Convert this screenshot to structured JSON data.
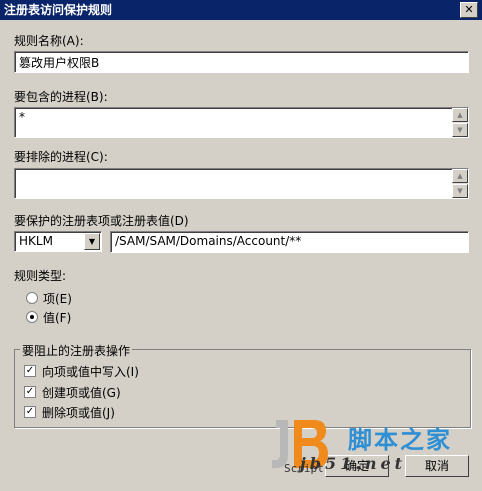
{
  "window": {
    "title": "注册表访问保护规则",
    "close_glyph": "✕"
  },
  "rule_name": {
    "label": "规则名称(A):",
    "value": "篡改用户权限B"
  },
  "include_processes": {
    "label": "要包含的进程(B):",
    "value": "*"
  },
  "exclude_processes": {
    "label": "要排除的进程(C):",
    "value": ""
  },
  "registry_key": {
    "label": "要保护的注册表项或注册表值(D)",
    "hive": "HKLM",
    "path": "/SAM/SAM/Domains/Account/**"
  },
  "rule_type": {
    "label": "规则类型:",
    "options": [
      {
        "label": "项(E)",
        "selected": false
      },
      {
        "label": "值(F)",
        "selected": true
      }
    ]
  },
  "operations": {
    "title": "要阻止的注册表操作",
    "items": [
      {
        "label": "向项或值中写入(I)",
        "checked": true
      },
      {
        "label": "创建项或值(G)",
        "checked": true
      },
      {
        "label": "删除项或值(J)",
        "checked": true
      }
    ]
  },
  "buttons": {
    "ok": "确定",
    "cancel": "取消"
  },
  "watermark": {
    "site_name": "脚本之家",
    "url": "jb51.net",
    "script": "Script"
  }
}
